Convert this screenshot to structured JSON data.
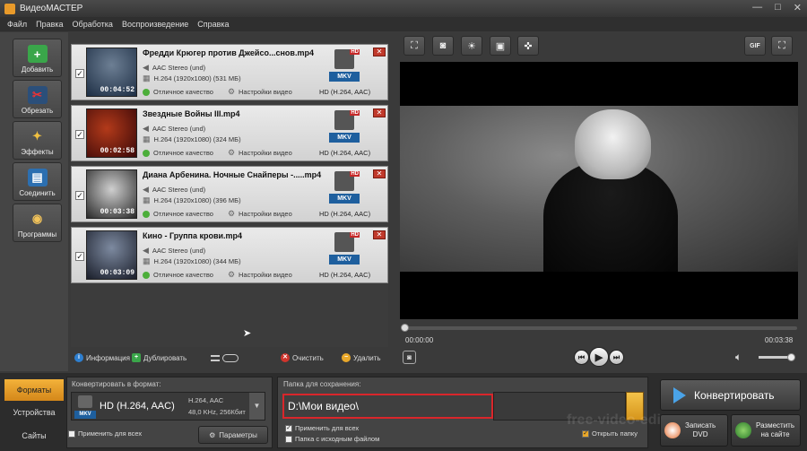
{
  "window": {
    "title": "ВидеоМАСТЕР",
    "controls": [
      "—",
      "□",
      "✕"
    ]
  },
  "menu": [
    "Файл",
    "Правка",
    "Обработка",
    "Воспроизведение",
    "Справка"
  ],
  "sidebar": [
    {
      "label": "Добавить",
      "icon": "add-film-icon",
      "color": "#3aa64a"
    },
    {
      "label": "Обрезать",
      "icon": "scissors-icon",
      "color": "#c33"
    },
    {
      "label": "Эффекты",
      "icon": "magic-wand-icon",
      "color": "#e1a72b"
    },
    {
      "label": "Соединить",
      "icon": "join-icon",
      "color": "#3a8fd4"
    },
    {
      "label": "Программы",
      "icon": "cd-icon",
      "color": "#e8b24a"
    }
  ],
  "files": [
    {
      "name": "Фредди Крюгер против Джейсо...снов.mp4",
      "duration": "00:04:52",
      "audio": "AAC Stereo (und)",
      "video": "H.264 (1920x1080) (531 МБ)",
      "quality": "Отличное качество",
      "settings": "Настройки видео",
      "format": "HD (H.264, AAC)",
      "thumb_color": "#1e2f45"
    },
    {
      "name": "Звездные Войны III.mp4",
      "duration": "00:02:58",
      "audio": "AAC Stereo (und)",
      "video": "H.264 (1920x1080) (324 МБ)",
      "quality": "Отличное качество",
      "settings": "Настройки видео",
      "format": "HD (H.264, AAC)",
      "thumb_color": "#5a1210"
    },
    {
      "name": "Диана Арбенина. Ночные Снайперы -.....mp4",
      "duration": "00:03:38",
      "audio": "AAC Stereo (und)",
      "video": "H.264 (1920x1080) (396 МБ)",
      "quality": "Отличное качество",
      "settings": "Настройки видео",
      "format": "HD (H.264, AAC)",
      "thumb_color": "#4a4a4a"
    },
    {
      "name": "Кино - Группа крови.mp4",
      "duration": "00:03:09",
      "audio": "AAC Stereo (und)",
      "video": "H.264 (1920x1080) (344 МБ)",
      "quality": "Отличное качество",
      "settings": "Настройки видео",
      "format": "HD (H.264, AAC)",
      "thumb_color": "#2a3040"
    }
  ],
  "badge": {
    "hd": "HD",
    "mkv": "MKV"
  },
  "listbar": {
    "info": "Информация",
    "duplicate": "Дублировать",
    "clear": "Очистить",
    "delete": "Удалить"
  },
  "preview": {
    "gif": "GIF",
    "time_current": "00:00:00",
    "time_total": "00:03:38"
  },
  "tabs": [
    "Форматы",
    "Устройства",
    "Сайты"
  ],
  "convert_to": {
    "label": "Конвертировать в формат:",
    "format": "HD (H.264, AAC)",
    "codec": "H.264, AAC",
    "audio": "48,0 KHz, 256Кбит",
    "apply_all": "Применить для всех",
    "params": "Параметры"
  },
  "save": {
    "label": "Папка для сохранения:",
    "path": "D:\\Мои видео\\",
    "apply_all": "Применить для всех",
    "same_folder": "Папка с исходным файлом",
    "open_folder": "Открыть папку"
  },
  "actions": {
    "convert": "Конвертировать",
    "dvd_1": "Записать",
    "dvd_2": "DVD",
    "web_1": "Разместить",
    "web_2": "на сайте"
  },
  "watermark": "free-video-editor"
}
